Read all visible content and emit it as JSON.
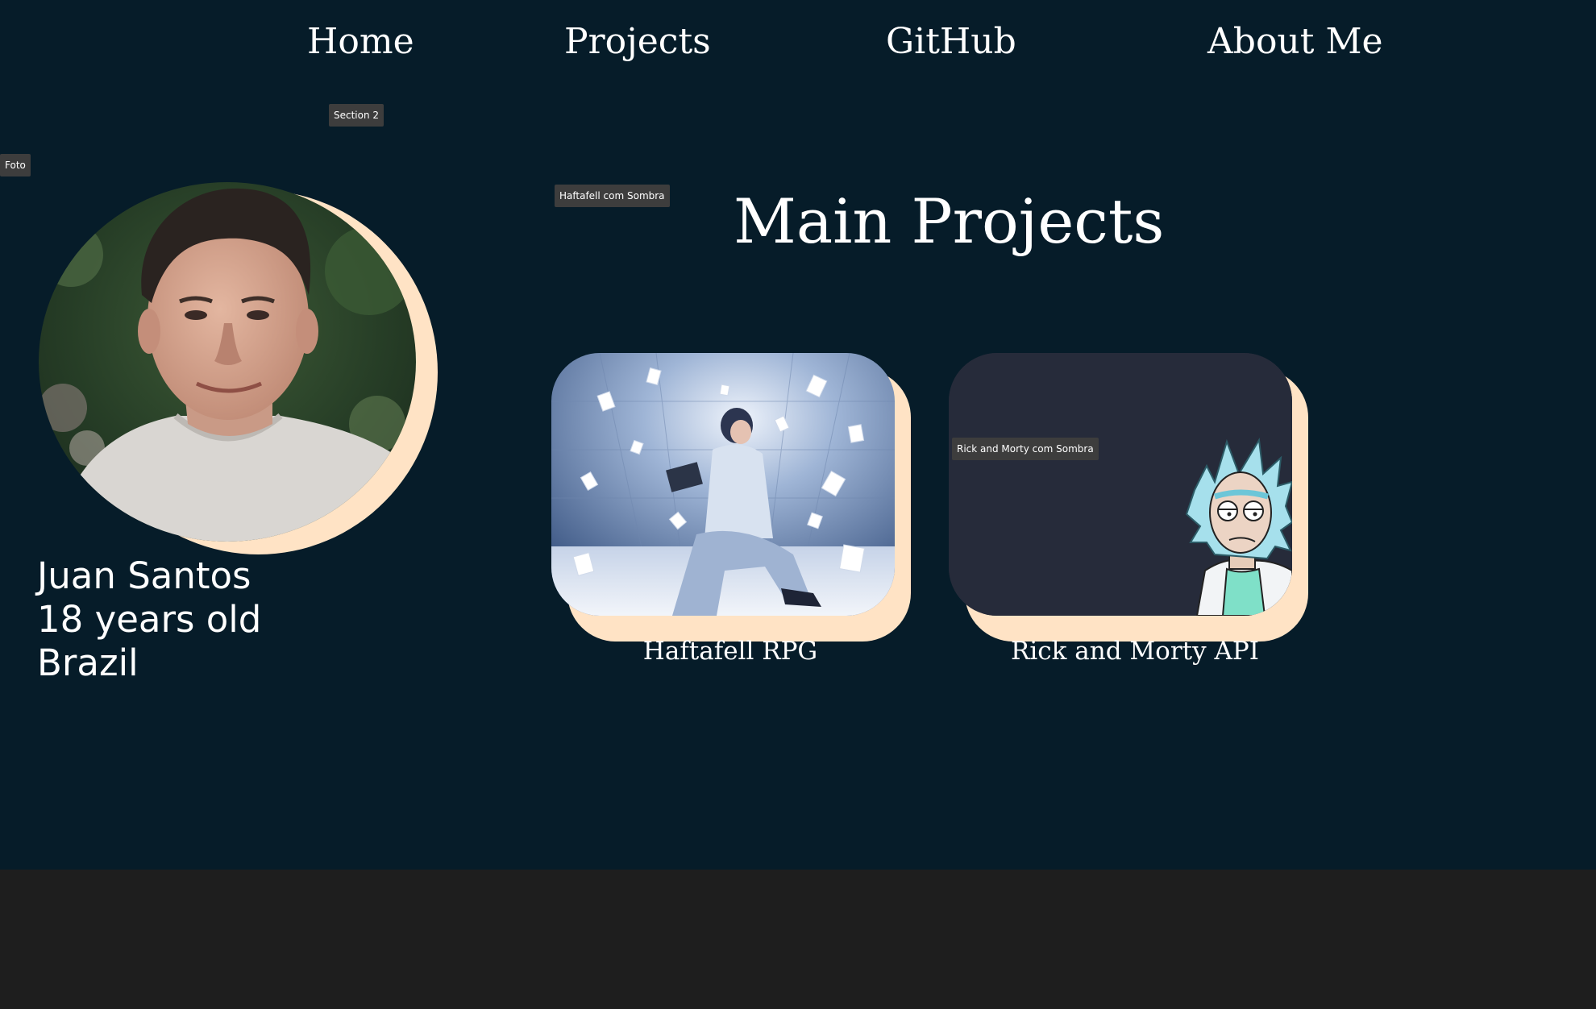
{
  "nav": {
    "home": "Home",
    "projects": "Projects",
    "github": "GitHub",
    "about": "About Me"
  },
  "layers": {
    "section": "Section 2",
    "photo": "Foto",
    "haftafell": "Haftafell com Sombra",
    "rick": "Rick and Morty com Sombra"
  },
  "profile": {
    "name": "Juan Santos",
    "age": "18 years old",
    "country": "Brazil"
  },
  "main": {
    "title": "Main Projects"
  },
  "projects": [
    {
      "label": "Haftafell RPG"
    },
    {
      "label": "Rick and Morty API"
    }
  ],
  "colors": {
    "page_bg": "#061c29",
    "canvas_bg": "#1e1e1e",
    "shadow_accent": "#ffe3c5",
    "card_dark": "#262b3a"
  }
}
